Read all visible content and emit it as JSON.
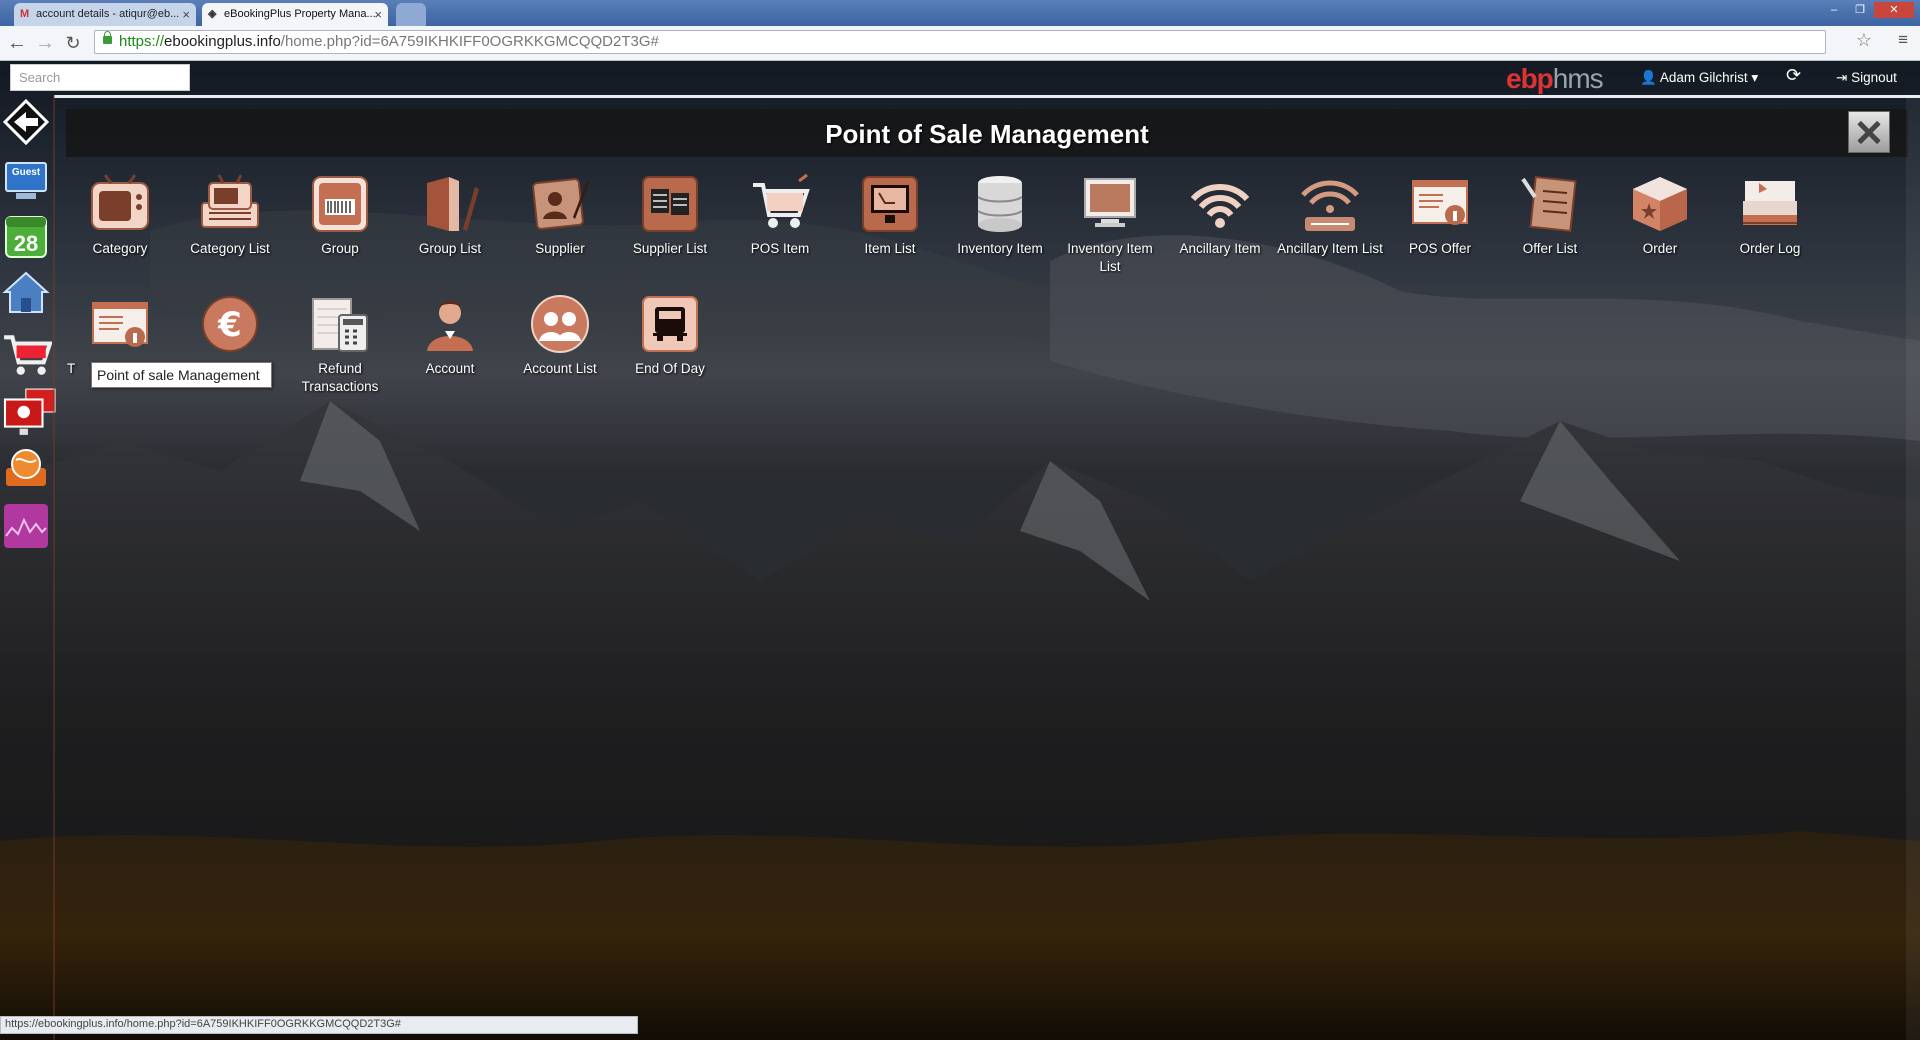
{
  "browser": {
    "tabs": [
      {
        "label": "account details - atiqur@eb...",
        "active": false
      },
      {
        "label": "eBookingPlus Property Mana...",
        "active": true
      }
    ],
    "url_scheme": "https://",
    "url_host": "ebookingplus.info",
    "url_path": "/home.php?id=6A759IKHKIFF0OGRKKGMCQQD2T3G#",
    "status_url": "https://ebookingplus.info/home.php?id=6A759IKHKIFF0OGRKKGMCQQD2T3G#"
  },
  "topbar": {
    "search_placeholder": "Search",
    "brand_red": "ebp",
    "brand_gray": "hms",
    "user_name": "Adam Gilchrist",
    "signout": "Signout"
  },
  "panel": {
    "title": "Point of Sale Management"
  },
  "tiles": [
    {
      "label": "Category",
      "icon": "tv-icon"
    },
    {
      "label": "Category List",
      "icon": "tv-list-icon"
    },
    {
      "label": "Group",
      "icon": "barcode-box-icon"
    },
    {
      "label": "Group List",
      "icon": "folder-pen-icon"
    },
    {
      "label": "Supplier",
      "icon": "supplier-icon"
    },
    {
      "label": "Supplier List",
      "icon": "documents-icon"
    },
    {
      "label": "POS Item",
      "icon": "cart-icon"
    },
    {
      "label": "Item List",
      "icon": "monitor-icon"
    },
    {
      "label": "Inventory Item",
      "icon": "database-icon"
    },
    {
      "label": "Inventory Item List",
      "icon": "display-icon"
    },
    {
      "label": "Ancillary Item",
      "icon": "wifi-icon"
    },
    {
      "label": "Ancillary Item List",
      "icon": "wifi-list-icon"
    },
    {
      "label": "POS Offer",
      "icon": "offer-certificate-icon"
    },
    {
      "label": "Offer List",
      "icon": "checklist-icon"
    },
    {
      "label": "Order",
      "icon": "box-icon"
    },
    {
      "label": "Order Log",
      "icon": "inbox-icon"
    },
    {
      "label": "T",
      "icon": "certificate-icon"
    },
    {
      "label": "",
      "icon": "euro-icon"
    },
    {
      "label": "Refund Transactions",
      "icon": "calculator-icon"
    },
    {
      "label": "Account",
      "icon": "person-icon"
    },
    {
      "label": "Account List",
      "icon": "people-icon"
    },
    {
      "label": "End Of Day",
      "icon": "truck-icon"
    }
  ],
  "tooltip": "Point of sale Management",
  "dock": [
    "back-arrow-icon",
    "guest-icon",
    "calendar-icon",
    "home-icon",
    "cart-icon",
    "monitor-icon",
    "globe-icon",
    "chart-icon"
  ],
  "calendar_day": "28",
  "guest_label": "Guest"
}
